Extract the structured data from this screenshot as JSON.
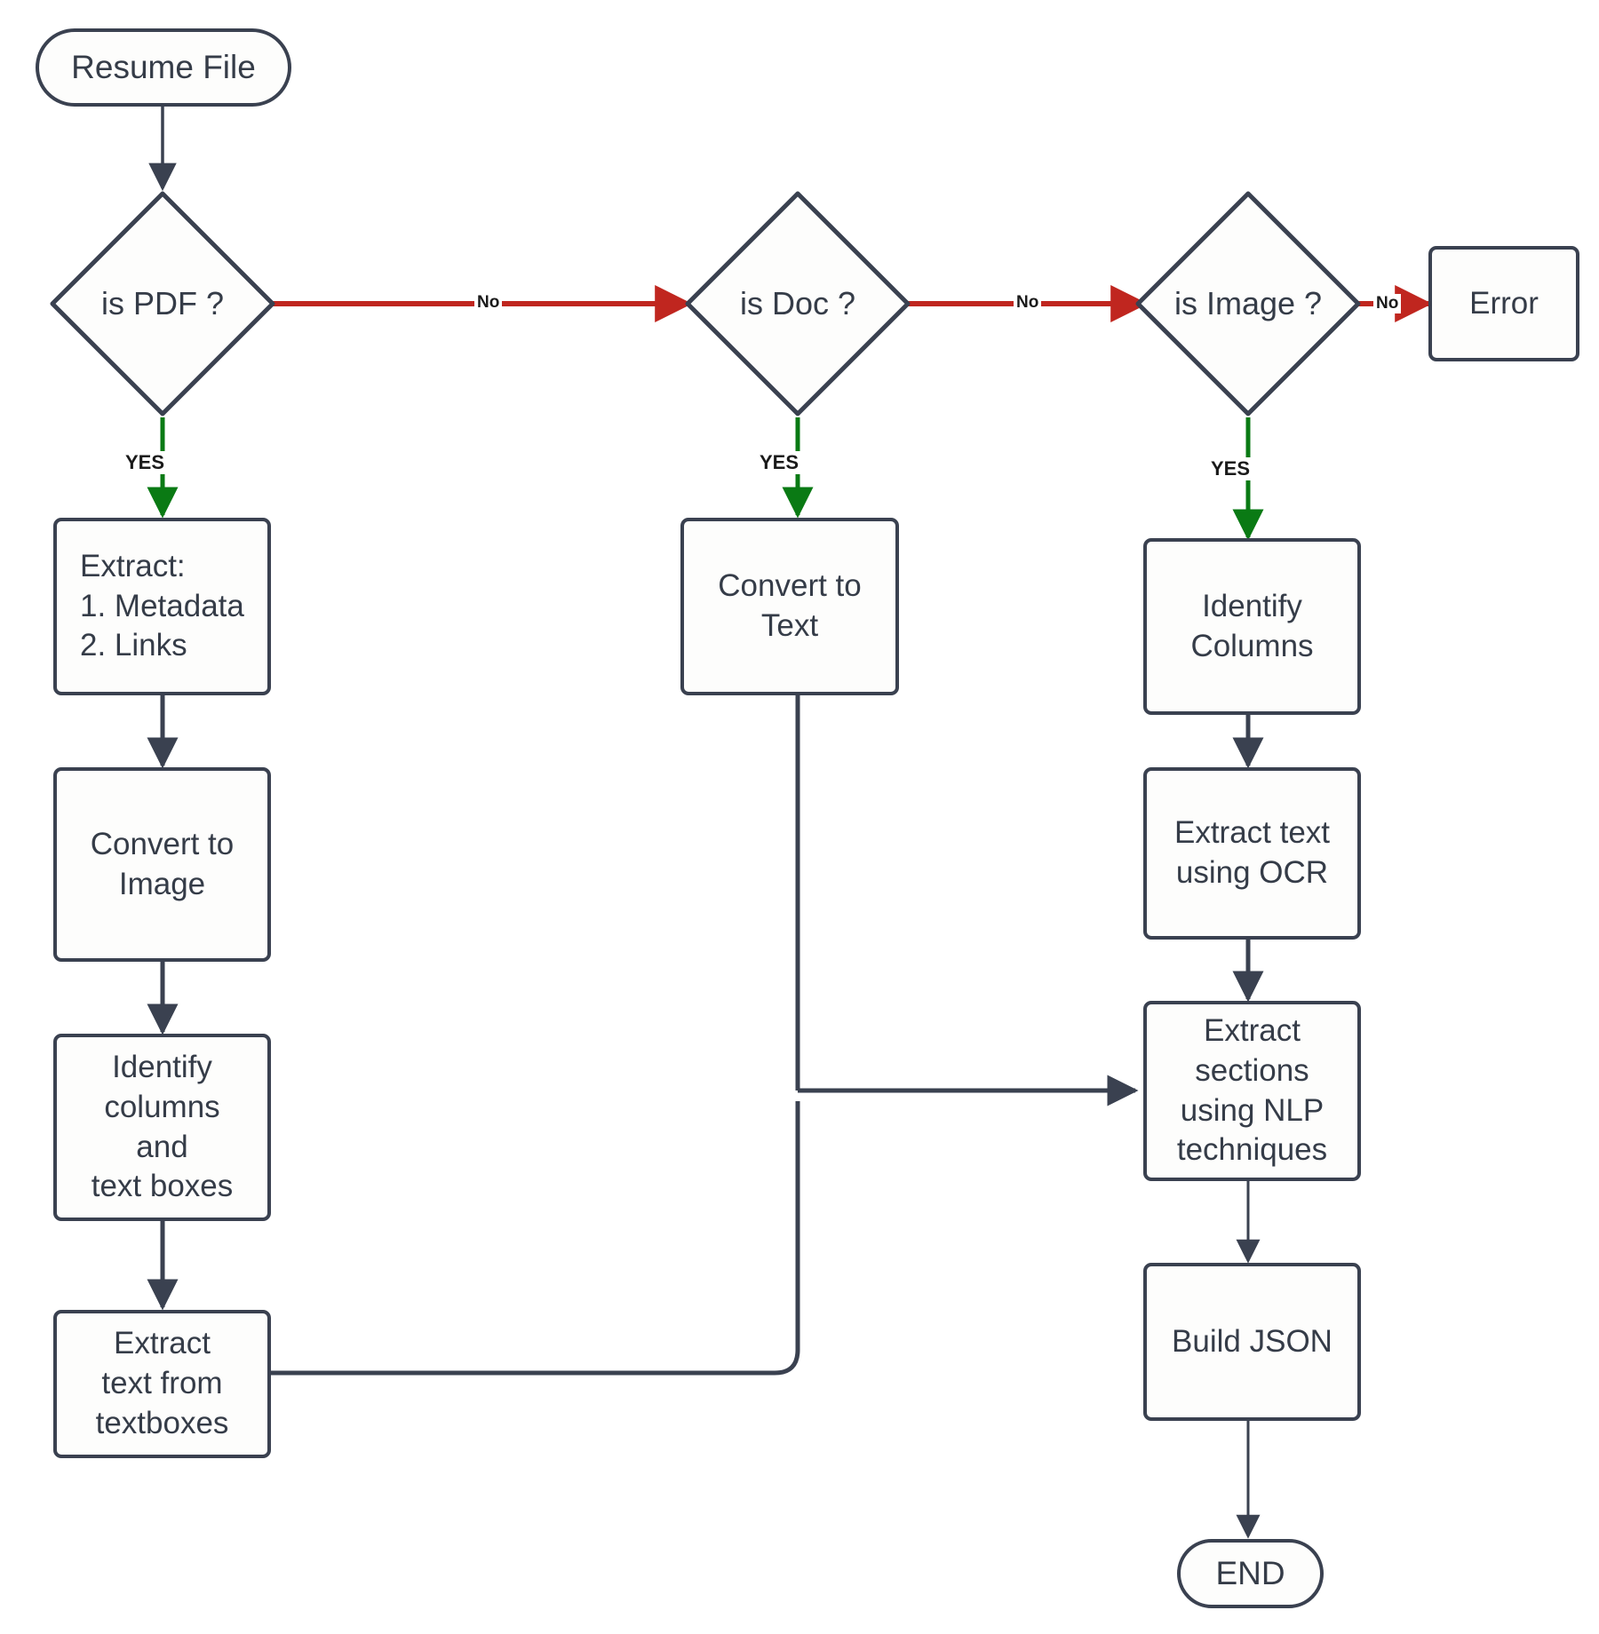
{
  "diagram": {
    "title": "Resume File Parsing Flowchart",
    "colors": {
      "node_stroke": "#3a4150",
      "node_fill": "#fdfdfc",
      "text": "#353c48",
      "edge_default": "#3a4150",
      "edge_no": "#c0261f",
      "edge_yes": "#0a7a14",
      "label_text": "#1a1a1a",
      "background": "#ffffff"
    },
    "nodes": [
      {
        "id": "start",
        "shape": "terminal",
        "label": "Resume File"
      },
      {
        "id": "is_pdf",
        "shape": "decision",
        "label": "is PDF ?"
      },
      {
        "id": "is_doc",
        "shape": "decision",
        "label": "is Doc ?"
      },
      {
        "id": "is_image",
        "shape": "decision",
        "label": "is Image ?"
      },
      {
        "id": "error",
        "shape": "process",
        "label": "Error"
      },
      {
        "id": "extract_meta",
        "shape": "process",
        "label_lines": [
          "Extract:",
          "1. Metadata",
          "2. Links"
        ]
      },
      {
        "id": "conv_image",
        "shape": "process",
        "label_lines": [
          "Convert to",
          "Image"
        ]
      },
      {
        "id": "id_cols_tb",
        "shape": "process",
        "label_lines": [
          "Identify",
          "columns",
          "and",
          "text boxes"
        ]
      },
      {
        "id": "extract_tb",
        "shape": "process",
        "label_lines": [
          "Extract",
          "text from",
          "textboxes"
        ]
      },
      {
        "id": "conv_text",
        "shape": "process",
        "label_lines": [
          "Convert to",
          "Text"
        ]
      },
      {
        "id": "id_columns",
        "shape": "process",
        "label_lines": [
          "Identify",
          "Columns"
        ]
      },
      {
        "id": "ocr",
        "shape": "process",
        "label_lines": [
          "Extract text",
          "using OCR"
        ]
      },
      {
        "id": "nlp",
        "shape": "process",
        "label_lines": [
          "Extract",
          "sections",
          "using NLP",
          "techniques"
        ]
      },
      {
        "id": "build_json",
        "shape": "process",
        "label": "Build JSON"
      },
      {
        "id": "end",
        "shape": "terminal",
        "label": "END"
      }
    ],
    "edges": [
      {
        "from": "start",
        "to": "is_pdf",
        "label": "",
        "kind": "default"
      },
      {
        "from": "is_pdf",
        "to": "is_doc",
        "label": "No",
        "kind": "no"
      },
      {
        "from": "is_doc",
        "to": "is_image",
        "label": "No",
        "kind": "no"
      },
      {
        "from": "is_image",
        "to": "error",
        "label": "No",
        "kind": "no"
      },
      {
        "from": "is_pdf",
        "to": "extract_meta",
        "label": "YES",
        "kind": "yes"
      },
      {
        "from": "is_doc",
        "to": "conv_text",
        "label": "YES",
        "kind": "yes"
      },
      {
        "from": "is_image",
        "to": "id_columns",
        "label": "YES",
        "kind": "yes"
      },
      {
        "from": "extract_meta",
        "to": "conv_image",
        "label": "",
        "kind": "default"
      },
      {
        "from": "conv_image",
        "to": "id_cols_tb",
        "label": "",
        "kind": "default"
      },
      {
        "from": "id_cols_tb",
        "to": "extract_tb",
        "label": "",
        "kind": "default"
      },
      {
        "from": "extract_tb",
        "to": "nlp",
        "label": "",
        "kind": "default"
      },
      {
        "from": "conv_text",
        "to": "nlp",
        "label": "",
        "kind": "default"
      },
      {
        "from": "id_columns",
        "to": "ocr",
        "label": "",
        "kind": "default"
      },
      {
        "from": "ocr",
        "to": "nlp",
        "label": "",
        "kind": "default"
      },
      {
        "from": "nlp",
        "to": "build_json",
        "label": "",
        "kind": "default"
      },
      {
        "from": "build_json",
        "to": "end",
        "label": "",
        "kind": "default"
      }
    ],
    "labels": {
      "start": "Resume File",
      "is_pdf": "is PDF ?",
      "is_doc": "is Doc ?",
      "is_image": "is Image ?",
      "error": "Error",
      "extract_meta_l1": "Extract:",
      "extract_meta_l2": "1. Metadata",
      "extract_meta_l3": "2. Links",
      "conv_image_l1": "Convert to",
      "conv_image_l2": "Image",
      "id_cols_tb_l1": "Identify",
      "id_cols_tb_l2": "columns",
      "id_cols_tb_l3": "and",
      "id_cols_tb_l4": "text boxes",
      "extract_tb_l1": "Extract",
      "extract_tb_l2": "text from",
      "extract_tb_l3": "textboxes",
      "conv_text_l1": "Convert to",
      "conv_text_l2": "Text",
      "id_columns_l1": "Identify",
      "id_columns_l2": "Columns",
      "ocr_l1": "Extract text",
      "ocr_l2": "using OCR",
      "nlp_l1": "Extract",
      "nlp_l2": "sections",
      "nlp_l3": "using NLP",
      "nlp_l4": "techniques",
      "build_json": "Build JSON",
      "end": "END",
      "no_pdf_doc": "No",
      "no_doc_image": "No",
      "no_image_error": "No",
      "yes_pdf": "YES",
      "yes_doc": "YES",
      "yes_image": "YES"
    }
  }
}
